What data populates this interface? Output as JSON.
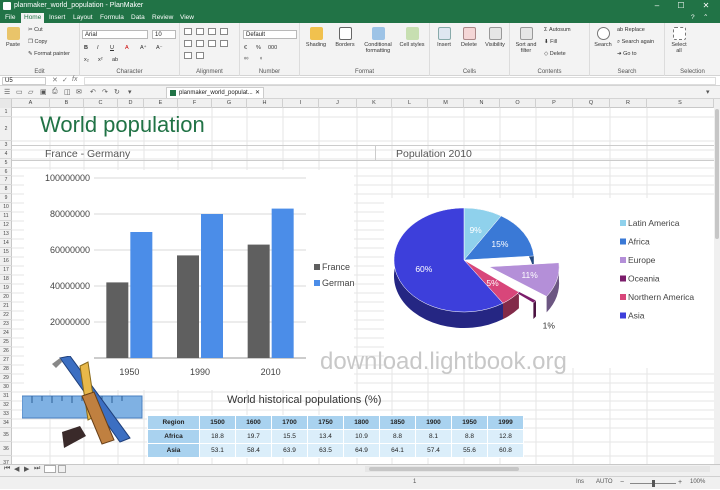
{
  "window": {
    "title": "planmaker_world_population - PlanMaker"
  },
  "menu": [
    "File",
    "Home",
    "Insert",
    "Layout",
    "Formula",
    "Data",
    "Review",
    "View"
  ],
  "ribbon": {
    "paste": "Paste",
    "cut": "Cut",
    "copy": "Copy",
    "format_painter": "Format painter",
    "font": "Arial",
    "font_size": "10",
    "number_format": "Default",
    "shading": "Shading",
    "borders": "Borders",
    "conditional_formatting": "Conditional formatting",
    "cell_styles": "Cell styles",
    "insert": "Insert",
    "delete": "Delete",
    "visibility": "Visibility",
    "sort_filter": "Sort and filter",
    "autosum": "Autosum",
    "fill": "Fill",
    "delete_small": "Delete",
    "search": "Search",
    "replace": "Replace",
    "search_again": "Search again",
    "goto": "Go to",
    "select_all": "Select all",
    "groups": [
      "Edit",
      "Character",
      "Alignment",
      "Number",
      "Format",
      "Cells",
      "Contents",
      "Search",
      "Selection"
    ]
  },
  "formula_bar": {
    "cell_ref": "U5"
  },
  "doc_tab": "planmaker_world_populat...",
  "columns": [
    "A",
    "B",
    "C",
    "D",
    "E",
    "F",
    "G",
    "H",
    "I",
    "J",
    "K",
    "L",
    "M",
    "N",
    "O",
    "P",
    "Q",
    "R",
    "S"
  ],
  "rows": [
    "1",
    "2",
    "3",
    "4",
    "5",
    "6",
    "7",
    "8",
    "9",
    "10",
    "11",
    "12",
    "13",
    "14",
    "15",
    "16",
    "17",
    "18",
    "19",
    "20",
    "21",
    "22",
    "23",
    "24",
    "25",
    "26",
    "27",
    "28",
    "29",
    "30",
    "31",
    "32",
    "33",
    "34",
    "35",
    "36",
    "37"
  ],
  "sheet": {
    "title": "World population",
    "subtitle_left": "France - Germany",
    "subtitle_right": "Population 2010",
    "table_title": "World historical populations (%)",
    "watermark": "download.lightbook.org"
  },
  "chart_data": [
    {
      "type": "bar",
      "categories": [
        "1950",
        "1990",
        "2010"
      ],
      "series": [
        {
          "name": "France",
          "values": [
            42000000,
            57000000,
            63000000
          ],
          "color": "#5f5f5f"
        },
        {
          "name": "Germany",
          "values": [
            70000000,
            80000000,
            83000000
          ],
          "color": "#4b8de8"
        }
      ],
      "yticks": [
        "100000000",
        "80000000",
        "60000000",
        "40000000",
        "20000000"
      ],
      "ylim": [
        0,
        100000000
      ],
      "grid": true,
      "legend": "right"
    },
    {
      "type": "pie",
      "slices": [
        {
          "name": "Latin America",
          "value": 9,
          "label": "9%",
          "color": "#8fd1ec"
        },
        {
          "name": "Africa",
          "value": 15,
          "label": "15%",
          "color": "#3a79d6"
        },
        {
          "name": "Europe",
          "value": 11,
          "label": "11%",
          "color": "#b48fd8"
        },
        {
          "name": "Oceania",
          "value": 1,
          "label": "1%",
          "color": "#7b1d6b"
        },
        {
          "name": "Northern America",
          "value": 5,
          "label": "5%",
          "color": "#d8467a"
        },
        {
          "name": "Asia",
          "value": 60,
          "label": "60%",
          "color": "#3d3fdb"
        }
      ],
      "legend": "right"
    }
  ],
  "table": {
    "header": [
      "Region",
      "1500",
      "1600",
      "1700",
      "1750",
      "1800",
      "1850",
      "1900",
      "1950",
      "1999"
    ],
    "rows": [
      [
        "Africa",
        "18.8",
        "19.7",
        "15.5",
        "13.4",
        "10.9",
        "8.8",
        "8.1",
        "8.8",
        "12.8"
      ],
      [
        "Asia",
        "53.1",
        "58.4",
        "63.9",
        "63.5",
        "64.9",
        "64.1",
        "57.4",
        "55.6",
        "60.8"
      ]
    ]
  },
  "status": {
    "mode": "Ins",
    "calc": "AUTO",
    "zoom": "100%"
  }
}
